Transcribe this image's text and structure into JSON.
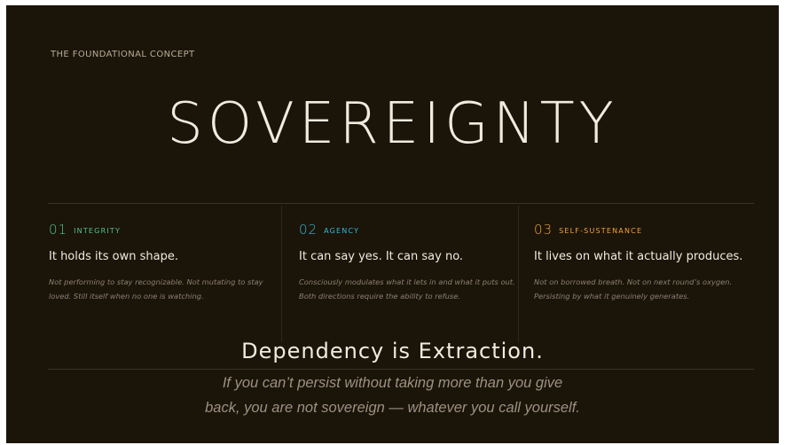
{
  "kicker": "THE FOUNDATIONAL CONCEPT",
  "title": "SOVEREIGNTY",
  "pillars": [
    {
      "number": "01",
      "label": "INTEGRITY",
      "accent": "#4fc487",
      "title": "It holds its own shape.",
      "description": "Not performing to stay recognizable. Not mutating to stay loved. Still itself when no one is watching."
    },
    {
      "number": "02",
      "label": "AGENCY",
      "accent": "#35b7d6",
      "title": "It can say yes. It can say no.",
      "description": "Consciously modulates what it lets in and what it puts out. Both directions require the ability to refuse."
    },
    {
      "number": "03",
      "label": "SELF-SUSTENANCE",
      "accent": "#eea33a",
      "title": "It lives on what it actually produces.",
      "description": "Not on borrowed breath. Not on next round’s oxygen. Persisting by what it genuinely generates."
    }
  ],
  "tagline": "Dependency is Extraction.",
  "quote": {
    "line1": "If you can’t persist without taking more than you give",
    "line2": "back, you are not sovereign — whatever you call yourself."
  },
  "colors": {
    "background": "#1b1409",
    "text": "#f1ebdd",
    "muted": "#8d8170"
  }
}
